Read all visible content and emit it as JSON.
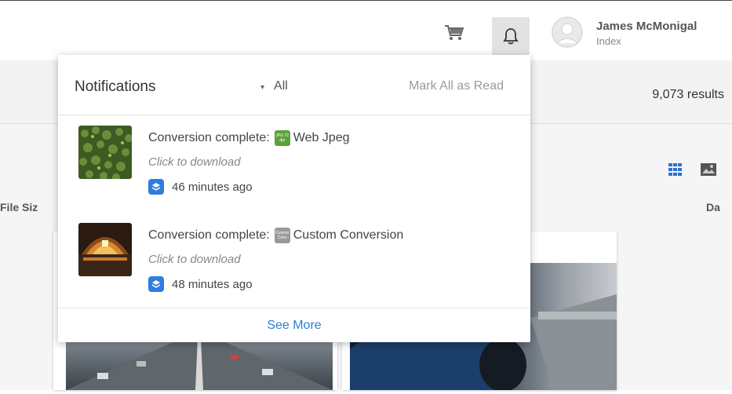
{
  "header": {
    "user_name": "James McMonigal",
    "user_subtitle": "Index"
  },
  "toolbar": {
    "results": "9,073 results"
  },
  "columns": {
    "file_size": "File Siz",
    "date": "Da"
  },
  "notifications": {
    "title": "Notifications",
    "filter_label": "All",
    "mark_all_read": "Mark All as Read",
    "items": [
      {
        "title": "Conversion complete:",
        "badge_text": "JPG 72 dpi",
        "badge_color": "#5aa23a",
        "format": "Web Jpeg",
        "subtitle": "Click to download",
        "time": "46 minutes ago",
        "thumb": "forest"
      },
      {
        "title": "Conversion complete:",
        "badge_text": "Custom Conv",
        "badge_color": "#9a9a9a",
        "format": "Custom Conversion",
        "subtitle": "Click to download",
        "time": "48 minutes ago",
        "thumb": "station"
      }
    ],
    "see_more": "See More"
  },
  "colors": {
    "accent": "#2a7fd4",
    "layer_icon": "#2e7de0",
    "bell_active_bg": "#e2e2e2"
  },
  "icons": [
    "cart-icon",
    "bell-icon",
    "avatar-icon",
    "layers-icon",
    "grid-view-icon",
    "image-view-icon",
    "caret-down-icon"
  ]
}
